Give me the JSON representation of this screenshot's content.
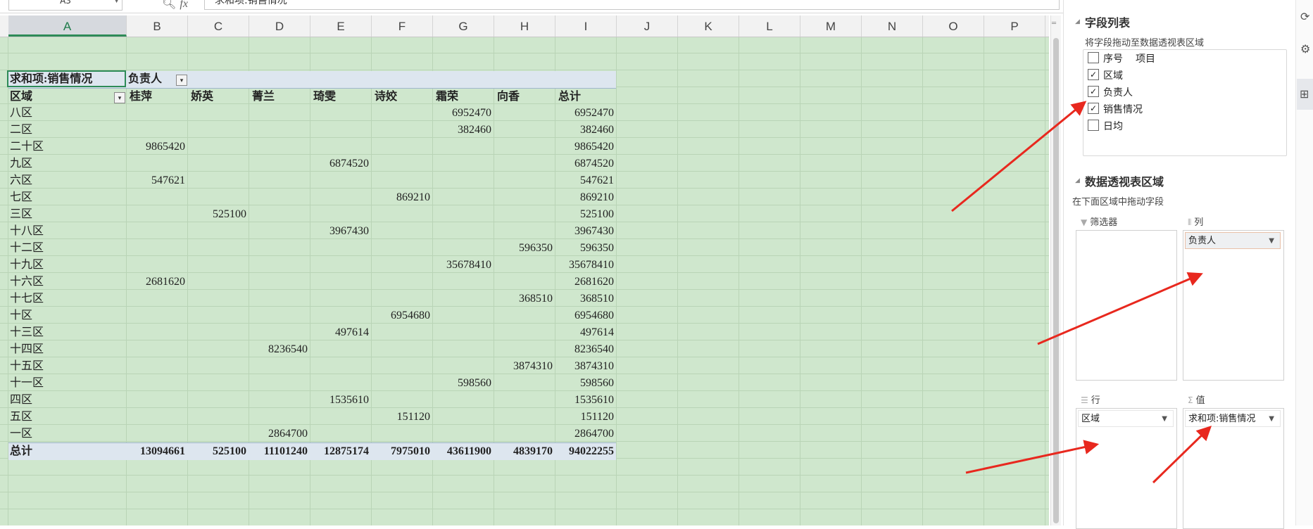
{
  "formula_bar": {
    "name_box": "A3",
    "fx": "fx",
    "formula": "求和项:销售情况"
  },
  "columns": [
    "A",
    "B",
    "C",
    "D",
    "E",
    "F",
    "G",
    "H",
    "I",
    "J",
    "K",
    "L",
    "M",
    "N",
    "O",
    "P"
  ],
  "pivot": {
    "title": "求和项:销售情况",
    "col_field": "负责人",
    "row_field": "区域",
    "col_headers": [
      "桂萍",
      "娇英",
      "菁兰",
      "琦雯",
      "诗姣",
      "霜荣",
      "向香",
      "总计"
    ],
    "rows": [
      {
        "label": "八区",
        "values": [
          "",
          "",
          "",
          "",
          "",
          "6952470",
          "",
          "6952470"
        ]
      },
      {
        "label": "二区",
        "values": [
          "",
          "",
          "",
          "",
          "",
          "382460",
          "",
          "382460"
        ]
      },
      {
        "label": "二十区",
        "values": [
          "9865420",
          "",
          "",
          "",
          "",
          "",
          "",
          "9865420"
        ]
      },
      {
        "label": "九区",
        "values": [
          "",
          "",
          "",
          "6874520",
          "",
          "",
          "",
          "6874520"
        ]
      },
      {
        "label": "六区",
        "values": [
          "547621",
          "",
          "",
          "",
          "",
          "",
          "",
          "547621"
        ]
      },
      {
        "label": "七区",
        "values": [
          "",
          "",
          "",
          "",
          "869210",
          "",
          "",
          "869210"
        ]
      },
      {
        "label": "三区",
        "values": [
          "",
          "525100",
          "",
          "",
          "",
          "",
          "",
          "525100"
        ]
      },
      {
        "label": "十八区",
        "values": [
          "",
          "",
          "",
          "3967430",
          "",
          "",
          "",
          "3967430"
        ]
      },
      {
        "label": "十二区",
        "values": [
          "",
          "",
          "",
          "",
          "",
          "",
          "596350",
          "596350"
        ]
      },
      {
        "label": "十九区",
        "values": [
          "",
          "",
          "",
          "",
          "",
          "35678410",
          "",
          "35678410"
        ]
      },
      {
        "label": "十六区",
        "values": [
          "2681620",
          "",
          "",
          "",
          "",
          "",
          "",
          "2681620"
        ]
      },
      {
        "label": "十七区",
        "values": [
          "",
          "",
          "",
          "",
          "",
          "",
          "368510",
          "368510"
        ]
      },
      {
        "label": "十区",
        "values": [
          "",
          "",
          "",
          "",
          "6954680",
          "",
          "",
          "6954680"
        ]
      },
      {
        "label": "十三区",
        "values": [
          "",
          "",
          "",
          "497614",
          "",
          "",
          "",
          "497614"
        ]
      },
      {
        "label": "十四区",
        "values": [
          "",
          "",
          "8236540",
          "",
          "",
          "",
          "",
          "8236540"
        ]
      },
      {
        "label": "十五区",
        "values": [
          "",
          "",
          "",
          "",
          "",
          "",
          "3874310",
          "3874310"
        ]
      },
      {
        "label": "十一区",
        "values": [
          "",
          "",
          "",
          "",
          "",
          "598560",
          "",
          "598560"
        ]
      },
      {
        "label": "四区",
        "values": [
          "",
          "",
          "",
          "1535610",
          "",
          "",
          "",
          "1535610"
        ]
      },
      {
        "label": "五区",
        "values": [
          "",
          "",
          "",
          "",
          "151120",
          "",
          "",
          "151120"
        ]
      },
      {
        "label": "一区",
        "values": [
          "",
          "",
          "2864700",
          "",
          "",
          "",
          "",
          "2864700"
        ]
      }
    ],
    "total": {
      "label": "总计",
      "values": [
        "13094661",
        "525100",
        "11101240",
        "12875174",
        "7975010",
        "43611900",
        "4839170",
        "94022255"
      ]
    }
  },
  "panel": {
    "field_list_title": "字段列表",
    "field_list_sub": "将字段拖动至数据透视表区域",
    "fields": [
      {
        "label": "序号",
        "extra": "项目",
        "checked": false
      },
      {
        "label": "区域",
        "checked": true
      },
      {
        "label": "负责人",
        "checked": true
      },
      {
        "label": "销售情况",
        "checked": true
      },
      {
        "label": "日均",
        "checked": false
      }
    ],
    "area_title": "数据透视表区域",
    "area_sub": "在下面区域中拖动字段",
    "filter_label": "筛选器",
    "columns_label": "列",
    "rows_label": "行",
    "values_label": "值",
    "columns_item": "负责人",
    "rows_item": "区域",
    "values_item": "求和项:销售情况"
  },
  "icons": {
    "filter": "filter-icon",
    "columns": "columns-icon",
    "rows": "rows-icon",
    "sigma": "sigma-icon"
  },
  "colors": {
    "sheet_bg": "#cfe7cd",
    "accent": "#2e8b57",
    "arrow": "#e8281e",
    "header_band": "#dde6ef"
  }
}
